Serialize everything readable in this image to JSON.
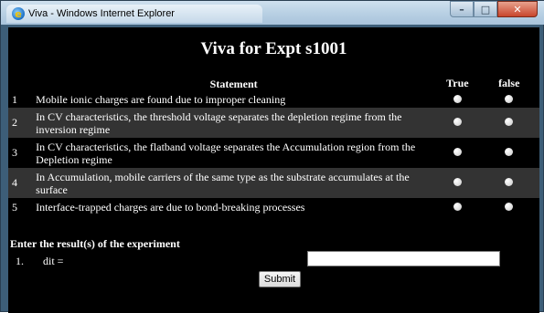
{
  "window": {
    "title": "Viva - Windows Internet Explorer",
    "icon": "ie-icon",
    "buttons": [
      "minimize",
      "maximize",
      "close"
    ]
  },
  "page": {
    "title": "Viva for Expt s1001"
  },
  "quiz": {
    "headers": {
      "statement": "Statement",
      "true": "True",
      "false": "false"
    },
    "rows": [
      {
        "num": "1",
        "statement": "Mobile ionic charges are found due to improper cleaning"
      },
      {
        "num": "2",
        "statement": "In CV characteristics, the threshold voltage separates the depletion regime from the inversion regime"
      },
      {
        "num": "3",
        "statement": "In CV characteristics, the flatband voltage separates the Accumulation region from the Depletion regime"
      },
      {
        "num": "4",
        "statement": "In Accumulation, mobile carriers of the same type as the substrate accumulates at the surface"
      },
      {
        "num": "5",
        "statement": "Interface-trapped charges are due to bond-breaking processes"
      }
    ]
  },
  "results": {
    "heading": "Enter the result(s) of the experiment",
    "items": [
      {
        "num": "1.",
        "label": "dit =",
        "value": ""
      }
    ],
    "submit_label": "Submit"
  }
}
